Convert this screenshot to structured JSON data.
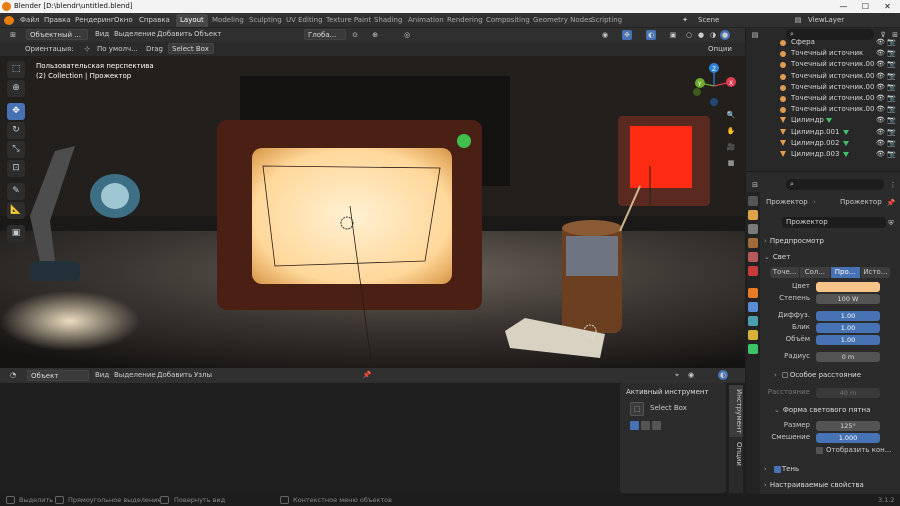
{
  "window": {
    "title": "Blender [D:\\blendr\\untitled.blend]",
    "min": "—",
    "max": "☐",
    "close": "✕"
  },
  "menu": [
    "Файл",
    "Правка",
    "Рендеринг",
    "Окно",
    "Справка"
  ],
  "workspaces": [
    "Layout",
    "Modeling",
    "Sculpting",
    "UV Editing",
    "Texture Paint",
    "Shading",
    "Animation",
    "Rendering",
    "Compositing",
    "Geometry Nodes",
    "Scripting"
  ],
  "scene": {
    "label": "Scene",
    "view_layer": "ViewLayer"
  },
  "viewport_header": {
    "mode": "Объектный ...",
    "menus": [
      "Вид",
      "Выделение",
      "Добавить",
      "Объект"
    ],
    "transform": "Глоба...",
    "orientation_label": "Ориентацыя:",
    "orientation_value": "По умолч...",
    "drag_label": "Drag",
    "drag_value": "Select Box",
    "options": "Опции"
  },
  "viewport": {
    "line1": "Пользовательская перспектива",
    "line2": "(2) Collection | Прожектор"
  },
  "gizmo": {
    "x": "X",
    "y": "Y",
    "z": "Z"
  },
  "node_header": {
    "type": "Объект",
    "menus": [
      "Вид",
      "Выделение",
      "Добавить",
      "Узлы"
    ]
  },
  "tool_panel": {
    "title": "Активный инструмент",
    "tool": "Select Box"
  },
  "side_tabs": [
    "Инструмент",
    "Опции"
  ],
  "statusbar": {
    "select": "Выделить",
    "box": "Прямоугольное выделение",
    "rotate": "Повернуть вид",
    "context": "Контекстное меню объектов",
    "version": "3.1.2"
  },
  "outliner": {
    "items": [
      {
        "name": "Сфера",
        "icon": "sphere-icon"
      },
      {
        "name": "Точечный источник",
        "icon": "point-light-icon"
      },
      {
        "name": "Точечный источник.00",
        "icon": "point-light-icon"
      },
      {
        "name": "Точечный источник.00",
        "icon": "point-light-icon"
      },
      {
        "name": "Точечный источник.00",
        "icon": "point-light-icon"
      },
      {
        "name": "Точечный источник.00",
        "icon": "point-light-icon"
      },
      {
        "name": "Точечный источник.00",
        "icon": "point-light-icon"
      },
      {
        "name": "Цилиндр",
        "icon": "mesh-icon"
      },
      {
        "name": "Цилиндр.001",
        "icon": "mesh-icon"
      },
      {
        "name": "Цилиндр.002",
        "icon": "mesh-icon"
      },
      {
        "name": "Цилиндр.003",
        "icon": "mesh-icon"
      }
    ]
  },
  "properties": {
    "breadcrumb_obj": "Прожектор",
    "breadcrumb_data": "Прожектор",
    "data_name": "Прожектор",
    "preview": "Предпросмотр",
    "light": "Свет",
    "light_types": [
      "Точе...",
      "Сол...",
      "Про...",
      "Исто..."
    ],
    "color_label": "Цвет",
    "color_value": "#f8c48b",
    "power_label": "Степень",
    "power_value": "100 W",
    "diffuse_label": "Диффуз.",
    "diffuse_value": "1.00",
    "specular_label": "Блик",
    "specular_value": "1.00",
    "volume_label": "Объём",
    "volume_value": "1.00",
    "radius_label": "Радиус",
    "radius_value": "0 m",
    "custom_distance": "Особое расстояние",
    "distance_label": "Расстояние",
    "distance_value": "40 m",
    "spot_shape": "Форма светового пятна",
    "size_label": "Размер",
    "size_value": "125°",
    "blend_label": "Смешение",
    "blend_value": "1.000",
    "show_cone": "Отобразить кон...",
    "shadow": "Тень",
    "custom_props": "Настраиваемые свойства"
  },
  "colors": {
    "accent": "#4772b3",
    "orange": "#e87d0d",
    "light_obj": "#e09c4f",
    "mesh": "#3fc36a"
  }
}
